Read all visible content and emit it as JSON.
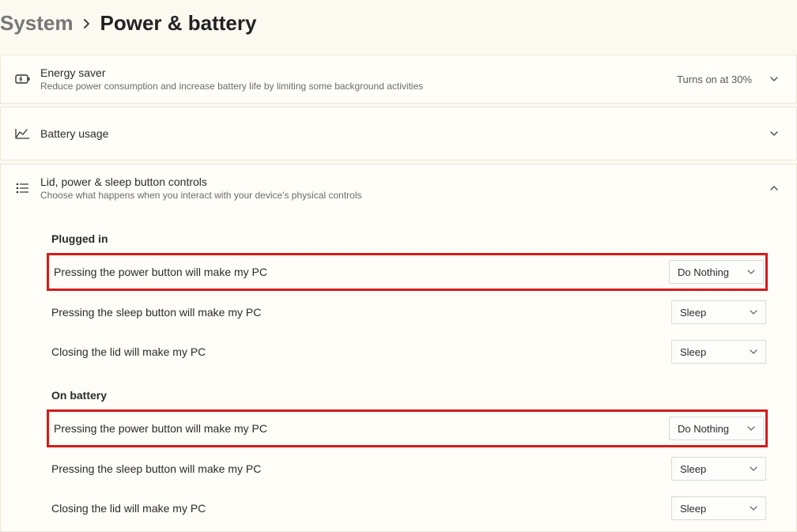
{
  "breadcrumb": {
    "parent": "System",
    "current": "Power & battery"
  },
  "energy_saver": {
    "title": "Energy saver",
    "desc": "Reduce power consumption and increase battery life by limiting some background activities",
    "status": "Turns on at 30%"
  },
  "battery_usage": {
    "title": "Battery usage"
  },
  "lid_controls": {
    "title": "Lid, power & sleep button controls",
    "desc": "Choose what happens when you interact with your device's physical controls"
  },
  "sections": {
    "plugged_in": {
      "title": "Plugged in",
      "rows": [
        {
          "label": "Pressing the power button will make my PC",
          "value": "Do Nothing"
        },
        {
          "label": "Pressing the sleep button will make my PC",
          "value": "Sleep"
        },
        {
          "label": "Closing the lid will make my PC",
          "value": "Sleep"
        }
      ]
    },
    "on_battery": {
      "title": "On battery",
      "rows": [
        {
          "label": "Pressing the power button will make my PC",
          "value": "Do Nothing"
        },
        {
          "label": "Pressing the sleep button will make my PC",
          "value": "Sleep"
        },
        {
          "label": "Closing the lid will make my PC",
          "value": "Sleep"
        }
      ]
    }
  }
}
